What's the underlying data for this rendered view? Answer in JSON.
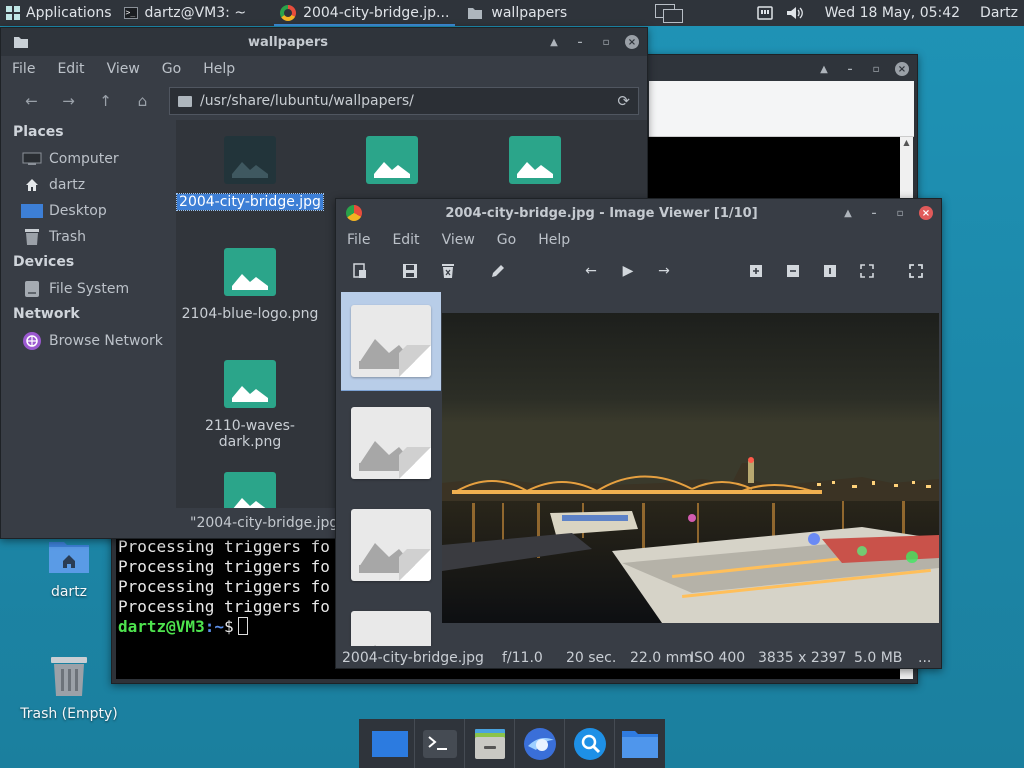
{
  "panel": {
    "applications_label": "Applications",
    "tasks": [
      {
        "label": "dartz@VM3: ~"
      },
      {
        "label": "2004-city-bridge.jp..."
      },
      {
        "label": "wallpapers"
      }
    ],
    "clock": "Wed 18 May, 05:42",
    "user": "Dartz"
  },
  "terminal": {
    "lines": [
      "Processing triggers fo",
      "Processing triggers fo",
      "Processing triggers fo",
      "Processing triggers fo"
    ],
    "prompt_user": "dartz@VM3",
    "prompt_path": ":~",
    "prompt_symbol": "$"
  },
  "file_manager": {
    "title": "wallpapers",
    "menu": [
      "File",
      "Edit",
      "View",
      "Go",
      "Help"
    ],
    "path": "/usr/share/lubuntu/wallpapers/",
    "sidebar": {
      "places_heading": "Places",
      "places": [
        "Computer",
        "dartz",
        "Desktop",
        "Trash"
      ],
      "devices_heading": "Devices",
      "devices": [
        "File System"
      ],
      "network_heading": "Network",
      "network": [
        "Browse Network"
      ]
    },
    "files": [
      {
        "name": "2004-city-bridge.jpg"
      },
      {
        "name": ""
      },
      {
        "name": ""
      },
      {
        "name": "2104-blue-logo.png"
      },
      {
        "name": "2110-waves-dark.png"
      },
      {
        "name": ""
      }
    ],
    "status": "\"2004-city-bridge.jpg\":"
  },
  "image_viewer": {
    "title": "2004-city-bridge.jpg - Image Viewer [1/10]",
    "menu": [
      "File",
      "Edit",
      "View",
      "Go",
      "Help"
    ],
    "status": {
      "filename": "2004-city-bridge.jpg",
      "aperture": "f/11.0",
      "exposure": "20 sec.",
      "focal_length": "22.0 mm",
      "iso": "ISO 400",
      "dimensions": "3835 x 2397",
      "size": "5.0 MB",
      "more": "..."
    }
  },
  "desktop": {
    "home_label": "dartz",
    "trash_label": "Trash (Empty)"
  },
  "colors": {
    "accent": "#3d7fd6",
    "wallpaper_icon": "#2ba58a",
    "desktop_bg": "#1f93b6"
  }
}
